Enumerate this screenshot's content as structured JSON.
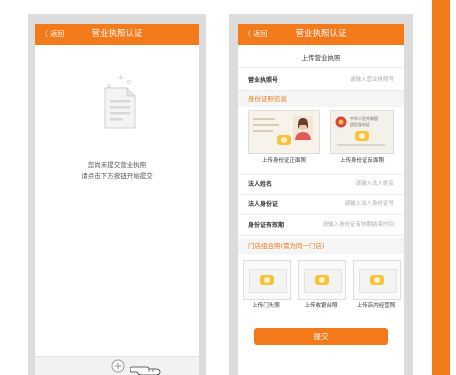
{
  "colors": {
    "accent": "#f27a1a",
    "placeholder": "#aaaaaa"
  },
  "left_screen": {
    "back_label": "〈 返回",
    "title": "营业执照认证",
    "empty_line1": "您尚未提交营业执照",
    "empty_line2": "请点击下方按钮开始提交",
    "add_icon": "plus-circle-icon",
    "hand_icon": "pointing-hand-icon"
  },
  "right_screen": {
    "back_label": "〈 返回",
    "title": "营业执照认证",
    "upload_license_label": "上传营业执照",
    "license_no_label": "营业执照号",
    "license_no_placeholder": "请输入营业执照号",
    "id_section_title": "身份证照信息",
    "id_front_caption": "上传身份证正面照",
    "id_back_caption": "上传身份证反面照",
    "id_card_text_line1": "中华人民共和国",
    "id_card_text_line2": "居民身份证",
    "legal_name_label": "法人姓名",
    "legal_name_placeholder": "请输入法人姓名",
    "legal_id_label": "法人身份证",
    "legal_id_placeholder": "请输入法人身份证号",
    "id_valid_label": "身份证有效期",
    "id_valid_placeholder": "请输入身份证有效期结束时间",
    "store_section_title": "门店组合照(需为同一门店)",
    "store_captions": [
      "上传门头照",
      "上传收银台照",
      "上传店内经营照"
    ],
    "submit_label": "提交"
  }
}
